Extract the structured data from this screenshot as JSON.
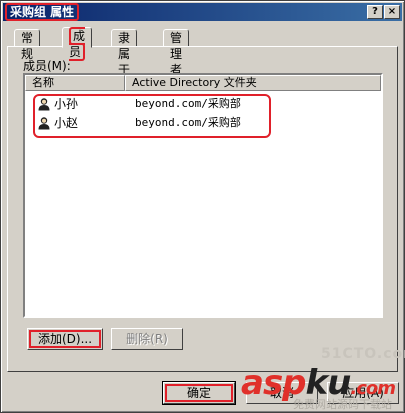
{
  "window": {
    "title": "采购组 属性",
    "help_button": "?",
    "close_button": "×"
  },
  "tabs": [
    {
      "label": "常规",
      "active": false
    },
    {
      "label": "成员",
      "active": true
    },
    {
      "label": "隶属于",
      "active": false
    },
    {
      "label": "管理者",
      "active": false
    }
  ],
  "members": {
    "label": "成员(M):",
    "columns": [
      "名称",
      "Active Directory 文件夹"
    ],
    "rows": [
      {
        "name": "小孙",
        "folder": "beyond.com/采购部"
      },
      {
        "name": "小赵",
        "folder": "beyond.com/采购部"
      }
    ]
  },
  "buttons": {
    "add": "添加(D)...",
    "remove": "删除(R)",
    "ok": "确定",
    "cancel": "取消",
    "apply": "应用(A)"
  },
  "watermarks": {
    "site1": "51CTO.com",
    "brand_a": "asp",
    "brand_b": "ku",
    "brand_c": ".com",
    "tagline": "免费网站源码下载站"
  },
  "colors": {
    "highlight": "#e0202a",
    "titlebar": "#0a246a",
    "face": "#d4d0c8"
  }
}
